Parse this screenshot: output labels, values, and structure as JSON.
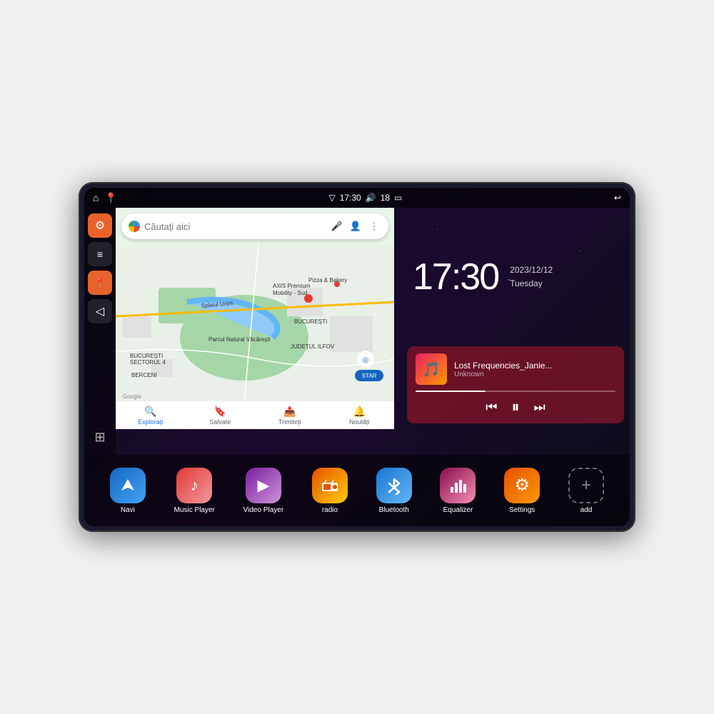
{
  "device": {
    "status_bar": {
      "left_icons": [
        "home",
        "map-pin"
      ],
      "time": "17:30",
      "right_icons": [
        "wifi",
        "volume",
        "18",
        "battery",
        "back"
      ],
      "signal": "▼17:30",
      "battery_level": "18"
    },
    "clock": {
      "time": "17:30",
      "date": "2023/12/12",
      "day": "Tuesday"
    },
    "music": {
      "title": "Lost Frequencies_Janie...",
      "artist": "Unknown",
      "album_art_emoji": "🎵"
    },
    "map": {
      "search_placeholder": "Căutați aici",
      "bottom_items": [
        {
          "label": "Explorați",
          "icon": "🔍"
        },
        {
          "label": "Salvate",
          "icon": "🔖"
        },
        {
          "label": "Trimiteți",
          "icon": "📤"
        },
        {
          "label": "Noutăți",
          "icon": "🔔"
        }
      ]
    },
    "apps": [
      {
        "id": "navi",
        "label": "Navi",
        "icon": "◎",
        "color": "navi"
      },
      {
        "id": "music-player",
        "label": "Music Player",
        "icon": "♪",
        "color": "music"
      },
      {
        "id": "video-player",
        "label": "Video Player",
        "icon": "▶",
        "color": "video"
      },
      {
        "id": "radio",
        "label": "radio",
        "icon": "📻",
        "color": "radio"
      },
      {
        "id": "bluetooth",
        "label": "Bluetooth",
        "icon": "⚡",
        "color": "bluetooth"
      },
      {
        "id": "equalizer",
        "label": "Equalizer",
        "icon": "⊞",
        "color": "equalizer"
      },
      {
        "id": "settings",
        "label": "Settings",
        "icon": "⚙",
        "color": "settings"
      },
      {
        "id": "add",
        "label": "add",
        "icon": "+",
        "color": "add"
      }
    ],
    "sidebar": [
      {
        "id": "settings",
        "icon": "⚙",
        "style": "orange"
      },
      {
        "id": "folder",
        "icon": "▬",
        "style": "dark"
      },
      {
        "id": "map",
        "icon": "📍",
        "style": "orange"
      },
      {
        "id": "nav",
        "icon": "◁",
        "style": "dark"
      },
      {
        "id": "grid",
        "icon": "⊞",
        "style": "grid"
      }
    ]
  }
}
